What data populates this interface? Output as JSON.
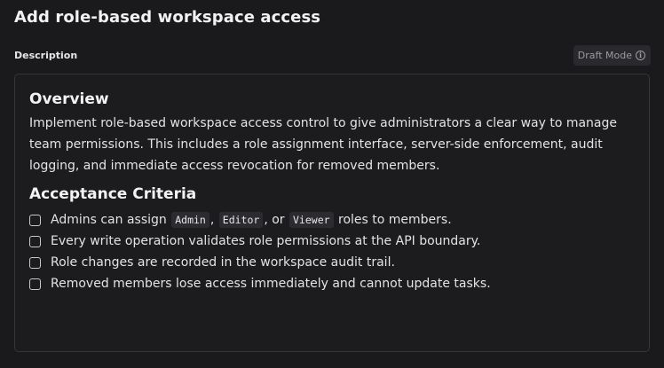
{
  "header": {
    "title": "Add role-based workspace access",
    "description_label": "Description",
    "draft_badge": "Draft Mode",
    "draft_icon": "info-icon"
  },
  "editor": {
    "overview": {
      "heading": "Overview",
      "body": "Implement role-based workspace access control to give administrators a clear way to manage team permissions. This includes a role assignment interface, server-side enforcement, audit logging, and immediate access revocation for removed members."
    },
    "acceptance": {
      "heading": "Acceptance Criteria",
      "item1": {
        "pre": "Admins can assign",
        "code1": "Admin",
        "sep1": ",",
        "code2": "Editor",
        "sep2": ", or",
        "code3": "Viewer",
        "post": "roles to members.",
        "checked": false
      },
      "item2": {
        "text": "Every write operation validates role permissions at the API boundary.",
        "checked": false
      },
      "item3": {
        "text": "Role changes are recorded in the workspace audit trail.",
        "checked": false
      },
      "item4": {
        "text": "Removed members lose access immediately and cannot update tasks.",
        "checked": false
      }
    }
  },
  "colors": {
    "background": "#1a1a1c",
    "editor_border": "#35353a",
    "badge_bg": "#2a2a2e",
    "code_bg": "#2b2b30"
  }
}
